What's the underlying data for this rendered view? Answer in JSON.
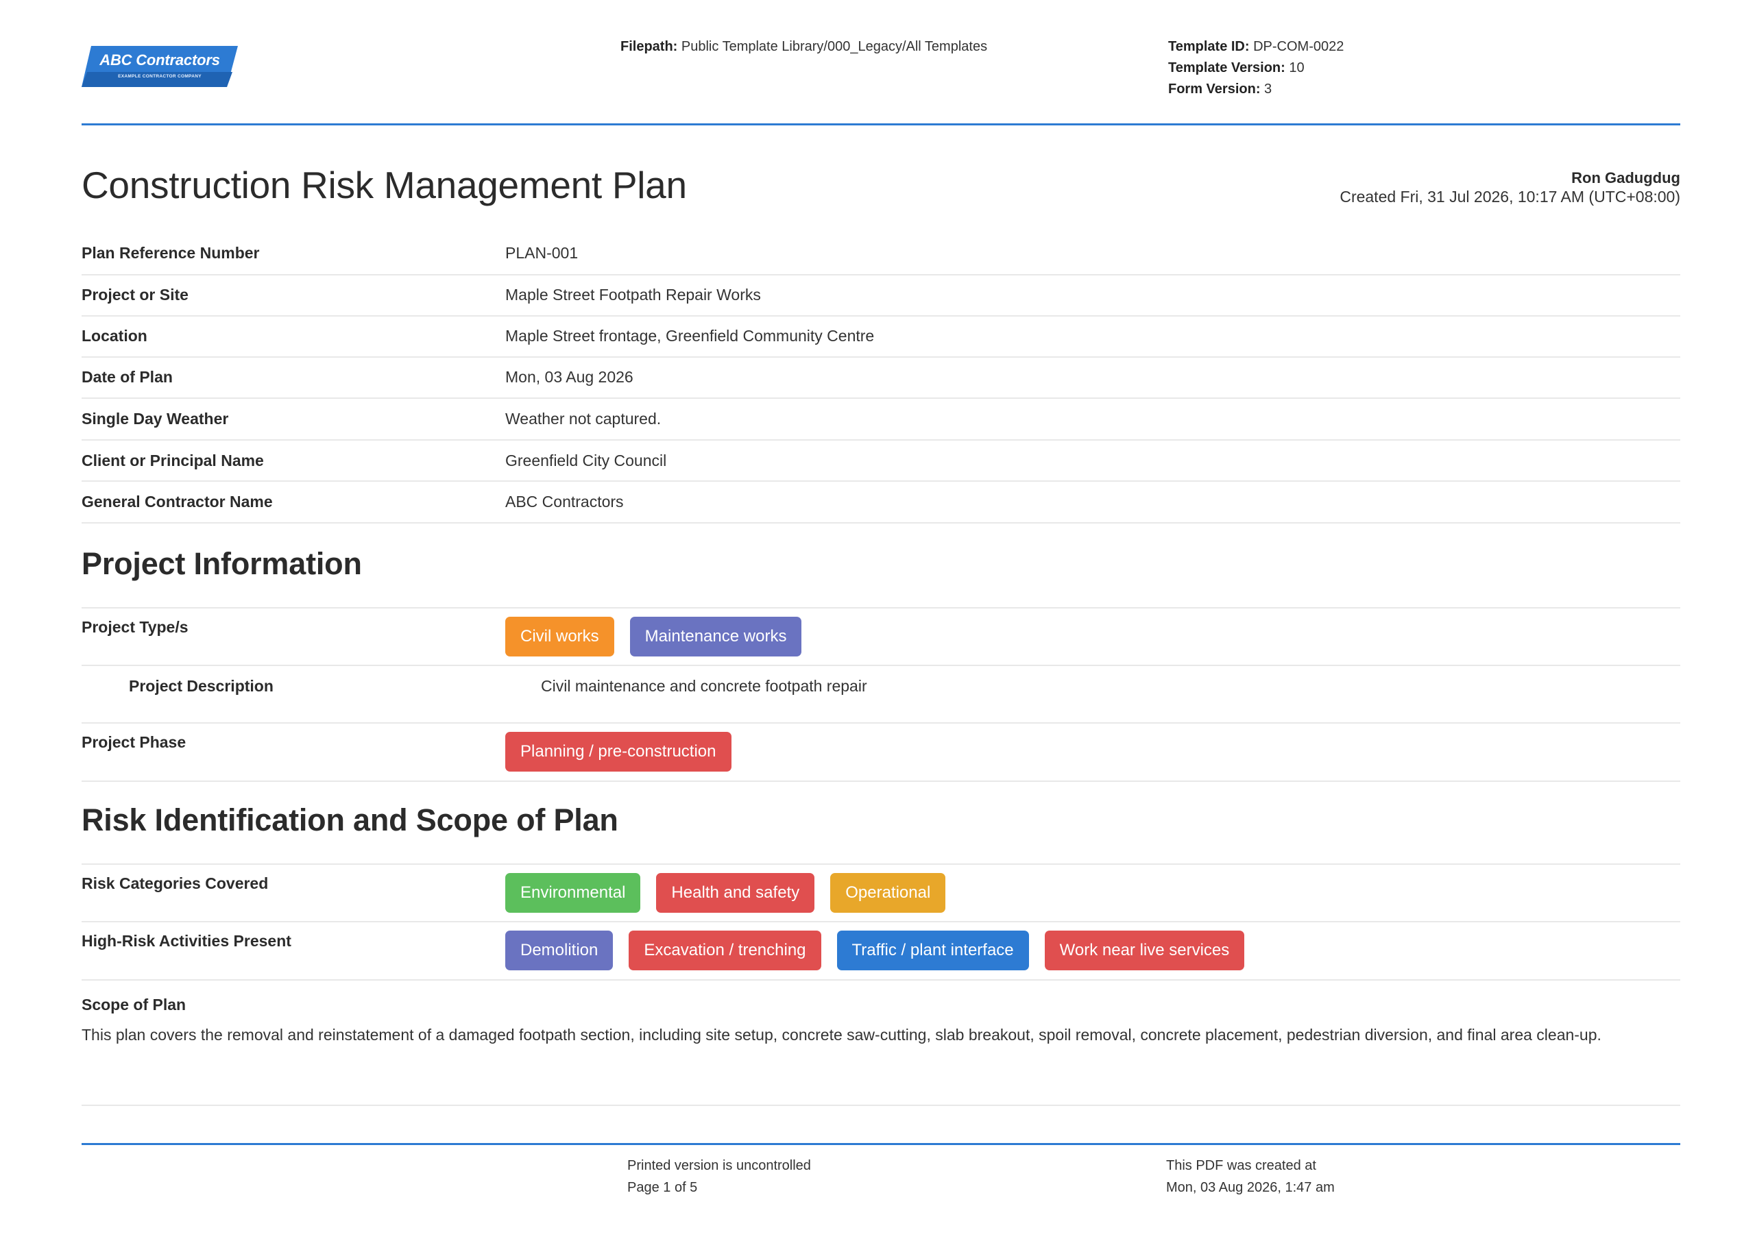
{
  "header": {
    "logo": {
      "name": "ABC Contractors",
      "tagline": "EXAMPLE CONTRACTOR COMPANY"
    },
    "filepath_label": "Filepath:",
    "filepath_value": "Public Template Library/000_Legacy/All Templates",
    "template_id_label": "Template ID:",
    "template_id_value": "DP-COM-0022",
    "template_version_label": "Template Version:",
    "template_version_value": "10",
    "form_version_label": "Form Version:",
    "form_version_value": "3"
  },
  "document": {
    "title": "Construction Risk Management Plan",
    "author": "Ron Gadugdug",
    "created": "Created Fri, 31 Jul 2026, 10:17 AM (UTC+08:00)"
  },
  "fields": [
    {
      "label": "Plan Reference Number",
      "value": "PLAN-001"
    },
    {
      "label": "Project or Site",
      "value": "Maple Street Footpath Repair Works"
    },
    {
      "label": "Location",
      "value": "Maple Street frontage, Greenfield Community Centre"
    },
    {
      "label": "Date of Plan",
      "value": "Mon, 03 Aug 2026"
    },
    {
      "label": "Single Day Weather",
      "value": "Weather not captured."
    },
    {
      "label": "Client or Principal Name",
      "value": "Greenfield City Council"
    },
    {
      "label": "General Contractor Name",
      "value": "ABC Contractors"
    }
  ],
  "project_information": {
    "heading": "Project Information",
    "project_types_label": "Project Type/s",
    "project_types": [
      {
        "label": "Civil works",
        "color": "#f5922a"
      },
      {
        "label": "Maintenance works",
        "color": "#6a73c1"
      }
    ],
    "description_label": "Project Description",
    "description_value": "Civil maintenance and concrete footpath repair",
    "phase_label": "Project Phase",
    "phase": [
      {
        "label": "Planning / pre-construction",
        "color": "#e04f4f"
      }
    ]
  },
  "risk_identification": {
    "heading": "Risk Identification and Scope of Plan",
    "categories_label": "Risk Categories Covered",
    "categories": [
      {
        "label": "Environmental",
        "color": "#5cbf5c"
      },
      {
        "label": "Health and safety",
        "color": "#e04f4f"
      },
      {
        "label": "Operational",
        "color": "#e8a72a"
      }
    ],
    "activities_label": "High-Risk Activities Present",
    "activities": [
      {
        "label": "Demolition",
        "color": "#6a73c1"
      },
      {
        "label": "Excavation / trenching",
        "color": "#e04f4f"
      },
      {
        "label": "Traffic / plant interface",
        "color": "#2d7bd3"
      },
      {
        "label": "Work near live services",
        "color": "#e04f4f"
      }
    ],
    "scope_label": "Scope of Plan",
    "scope_text": "This plan covers the removal and reinstatement of a damaged footpath section, including site setup, concrete saw-cutting, slab breakout, spoil removal, concrete placement, pedestrian diversion, and final area clean-up."
  },
  "footer": {
    "uncontrolled": "Printed version is uncontrolled",
    "page": "Page 1 of 5",
    "pdf_created_label": "This PDF was created at",
    "pdf_created_value": "Mon, 03 Aug 2026, 1:47 am"
  },
  "colors": {
    "accent": "#2d7bd3",
    "divider": "#e8e8e8"
  }
}
